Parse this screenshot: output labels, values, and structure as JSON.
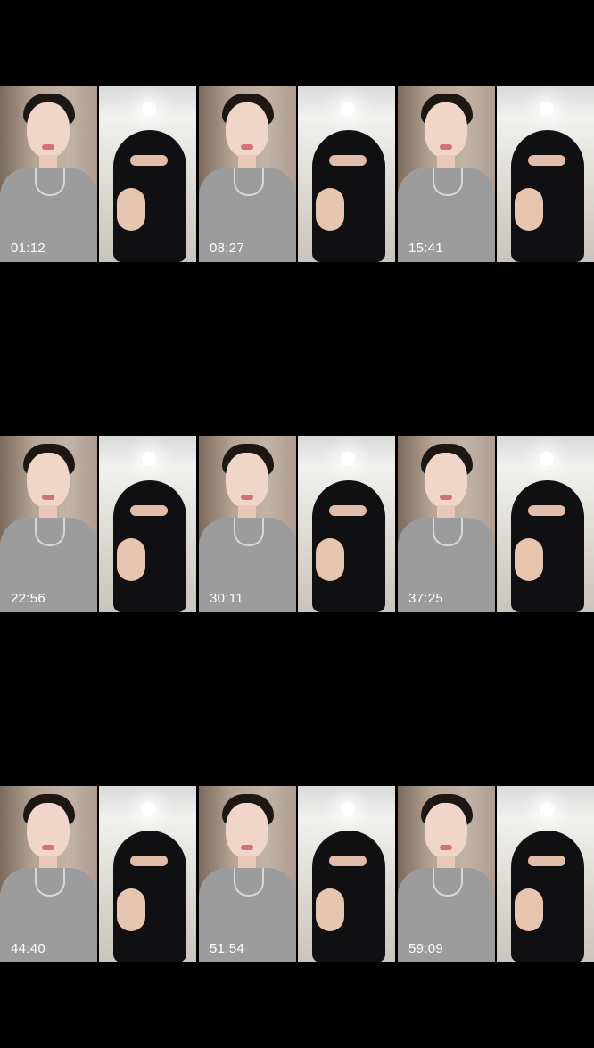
{
  "thumbnails": [
    {
      "time": "01:12"
    },
    {
      "time": "08:27"
    },
    {
      "time": "15:41"
    },
    {
      "time": "22:56"
    },
    {
      "time": "30:11"
    },
    {
      "time": "37:25"
    },
    {
      "time": "44:40"
    },
    {
      "time": "51:54"
    },
    {
      "time": "59:09"
    }
  ]
}
